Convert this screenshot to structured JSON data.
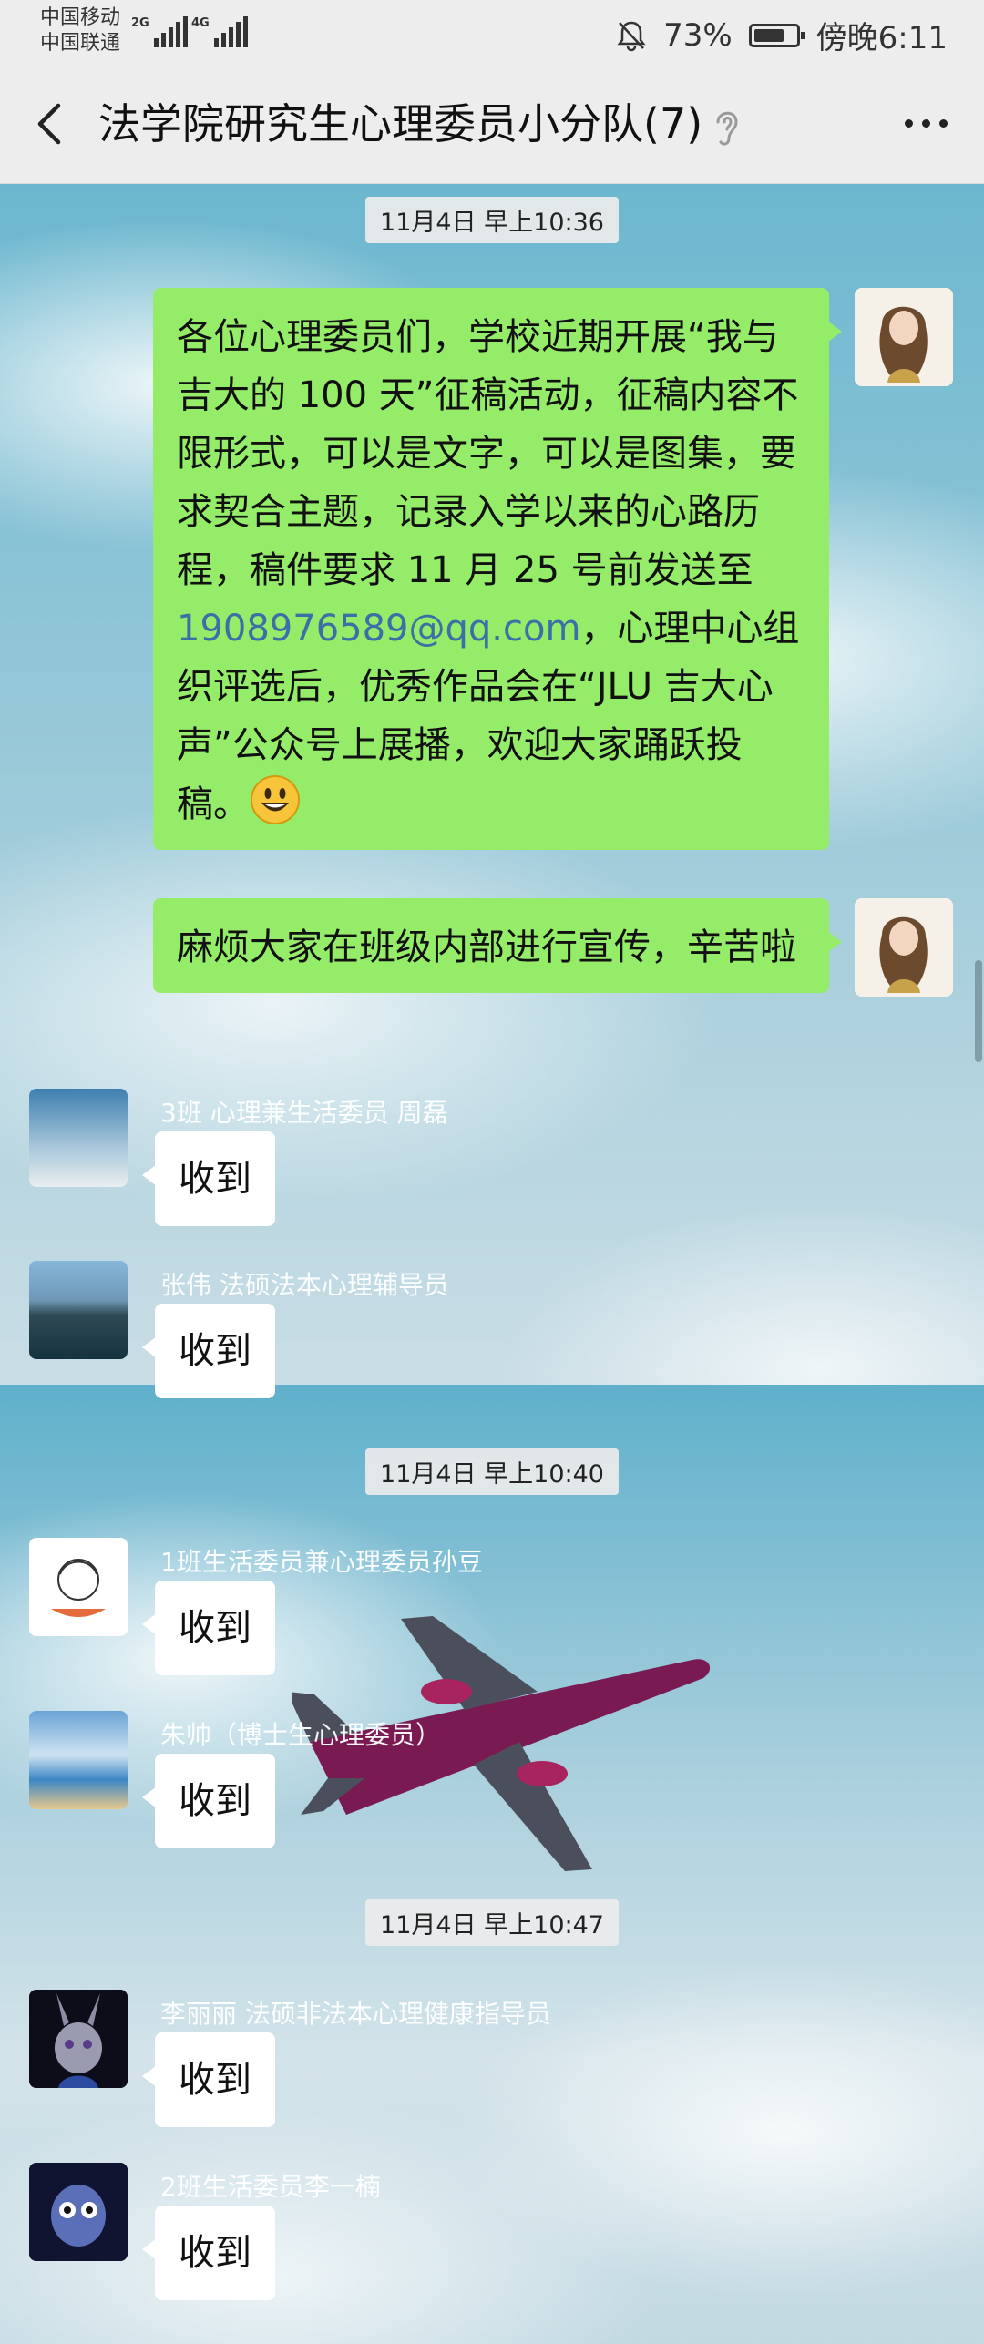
{
  "status_bar": {
    "carrier_1": "中国移动",
    "carrier_2": "中国联通",
    "signal_1": "2G",
    "signal_2": "4G",
    "battery": "73%",
    "battery_level": 0.73,
    "time": "傍晚6:11"
  },
  "header": {
    "title": "法学院研究生心理委员小分队(7)"
  },
  "messages": {
    "ts1": "11月4日 早上10:36",
    "m1": {
      "text_before": "各位心理委员们，学校近期开展“我与吉大的 100 天”征稿活动，征稿内容不限形式，可以是文字，可以是图集，要求契合主题，记录入学以来的心路历程，稿件要求 11 月 25 号前发送至 ",
      "email": "1908976589@qq.com",
      "text_after": "，心理中心组织评选后，优秀作品会在“JLU 吉大心声”公众号上展播，欢迎大家踊跃投稿。"
    },
    "m2": "麻烦大家在班级内部进行宣传，辛苦啦",
    "m3": {
      "sender": "3班 心理兼生活委员 周磊",
      "text": "收到"
    },
    "m4": {
      "sender": "张伟 法硕法本心理辅导员",
      "text": "收到"
    },
    "ts2": "11月4日 早上10:40",
    "m5": {
      "sender": "1班生活委员兼心理委员孙豆",
      "text": "收到"
    },
    "m6": {
      "sender": "朱帅（博士生心理委员）",
      "text": "收到"
    },
    "ts3": "11月4日 早上10:47",
    "m7": {
      "sender": "李丽丽 法硕非法本心理健康指导员",
      "text": "收到"
    },
    "m8": {
      "sender": "2班生活委员李一楠",
      "text": "收到"
    }
  },
  "icons": {
    "back": "chevron-left-icon",
    "ear": "ear-icon",
    "more": "more-dots-icon",
    "mute": "bell-off-icon",
    "emoji": "smiley-emoji"
  }
}
